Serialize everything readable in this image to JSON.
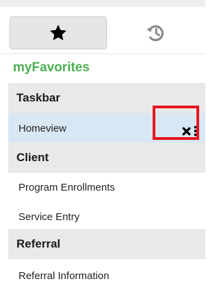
{
  "header": {
    "tabs": [
      {
        "name": "favorites",
        "icon": "star-icon",
        "selected": true
      },
      {
        "name": "history",
        "icon": "history-icon",
        "selected": false
      }
    ]
  },
  "title": "myFavorites",
  "sections": [
    {
      "label": "Taskbar",
      "items": [
        {
          "label": "Homeview",
          "selected": true,
          "actions": [
            "close-icon",
            "more-vertical-icon"
          ]
        }
      ]
    },
    {
      "label": "Client",
      "items": [
        {
          "label": "Program Enrollments"
        },
        {
          "label": "Service Entry"
        }
      ]
    },
    {
      "label": "Referral",
      "items": [
        {
          "label": "Referral Information"
        }
      ]
    }
  ],
  "colors": {
    "title": "#4caf50",
    "selected_row": "#d7e7f3",
    "section_header": "#e9e9e9",
    "highlight": "#e8141c"
  }
}
